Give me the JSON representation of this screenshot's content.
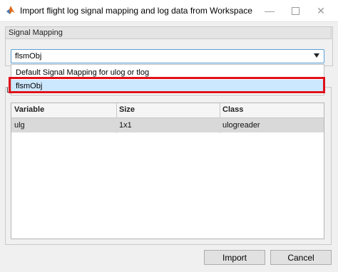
{
  "window": {
    "title": "Import flight log signal mapping and log data from Workspace",
    "controls": [
      "minimize",
      "maximize",
      "close"
    ]
  },
  "signal_mapping": {
    "panel_label": "Signal Mapping",
    "selected_value": "flsmObj",
    "options": [
      "Default Signal Mapping for ulog or tlog",
      "flsmObj"
    ]
  },
  "log_data": {
    "panel_label_visible": "L",
    "columns": [
      "Variable",
      "Size",
      "Class"
    ],
    "rows": [
      {
        "variable": "ulg",
        "size": "1x1",
        "class": "ulogreader"
      }
    ]
  },
  "buttons": {
    "import": "Import",
    "cancel": "Cancel"
  },
  "colors": {
    "highlight": "#e0111a",
    "selected_option": "#cce8ff",
    "focus_border": "#5a9fd4"
  },
  "icons": {
    "app": "matlab-icon",
    "minimize": "minimize-icon",
    "maximize": "maximize-icon",
    "close": "close-icon",
    "dropdown": "chevron-down-icon"
  }
}
